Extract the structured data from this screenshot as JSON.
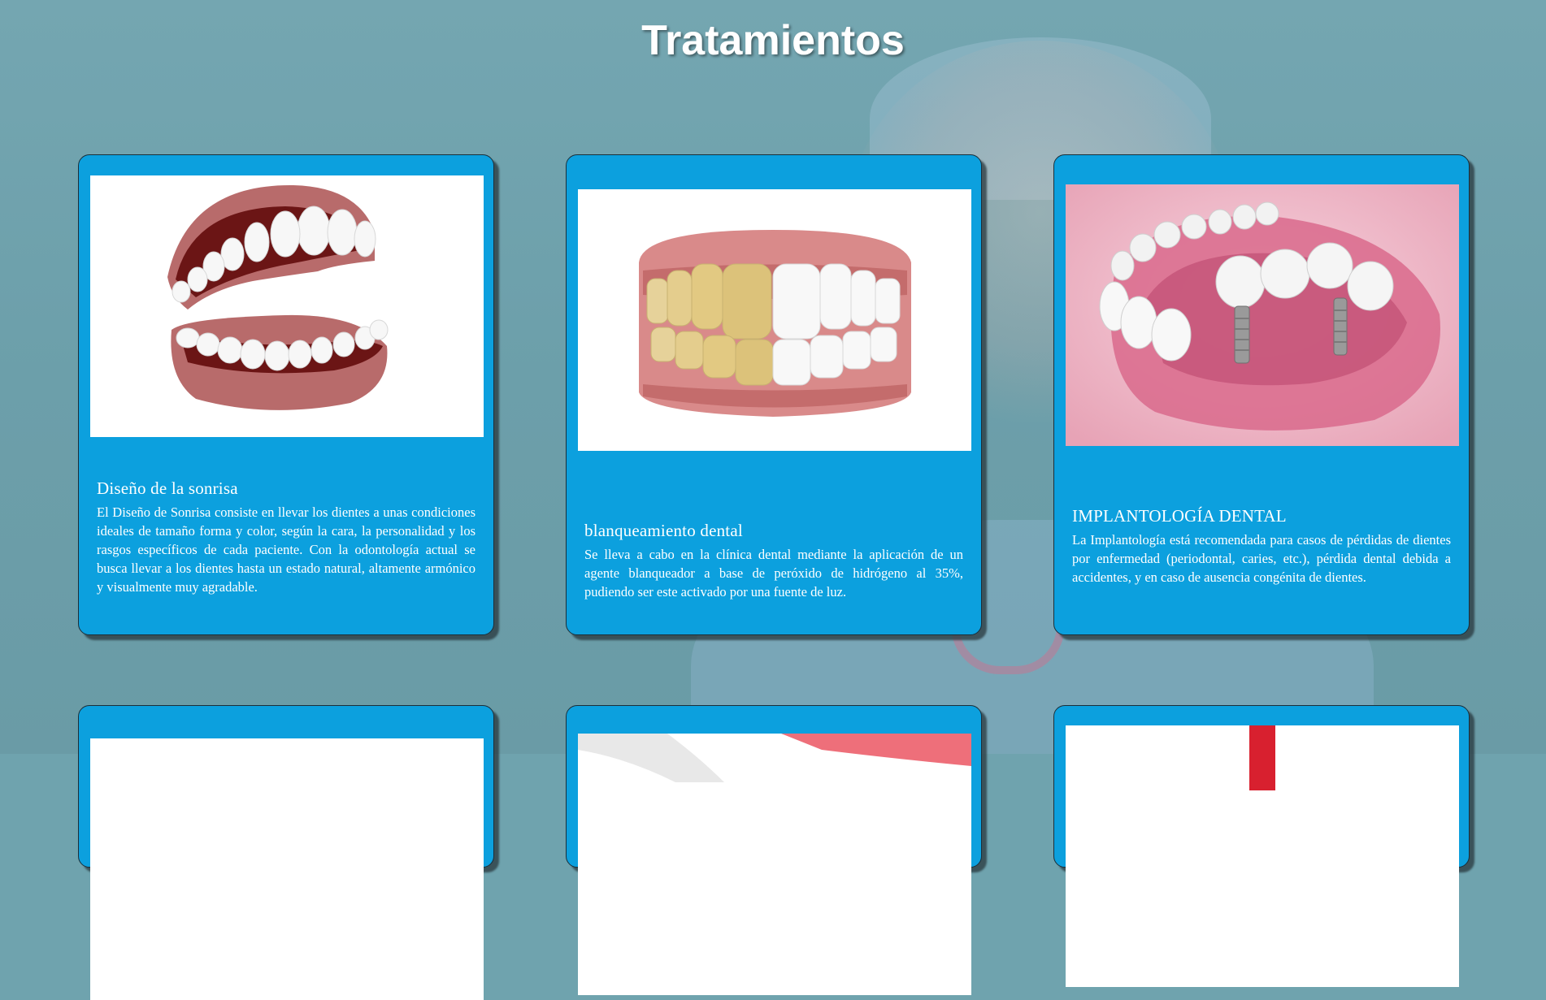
{
  "page": {
    "title": "Tratamientos"
  },
  "colors": {
    "card": "#0ca0de",
    "background": "#6fa3ae",
    "title": "#ffffff"
  },
  "treatments": [
    {
      "title": "Diseño de la sonrisa",
      "description": "El Diseño de Sonrisa consiste en llevar los dientes a unas condiciones ideales de tamaño forma y color, según la cara, la personalidad y los rasgos específicos de cada paciente. Con la odontología actual se busca llevar a los dientes hasta un estado natural, altamente armónico y visualmente muy agradable.",
      "image": "smile-design-teeth-image"
    },
    {
      "title": "blanqueamiento dental",
      "description": "Se lleva a cabo en la clínica dental mediante la aplicación de un agente blanqueador a base de peróxido de hidrógeno al 35%, pudiendo ser este activado por una fuente de luz.",
      "image": "teeth-whitening-image"
    },
    {
      "title": "IMPLANTOLOGÍA DENTAL",
      "description": "La Implantología está recomendada para casos de pérdidas de dientes por enfermedad (periodontal, caries, etc.), pérdida dental debida a accidentes, y en caso de ausencia congénita de dientes.",
      "image": "dental-implant-image"
    }
  ]
}
